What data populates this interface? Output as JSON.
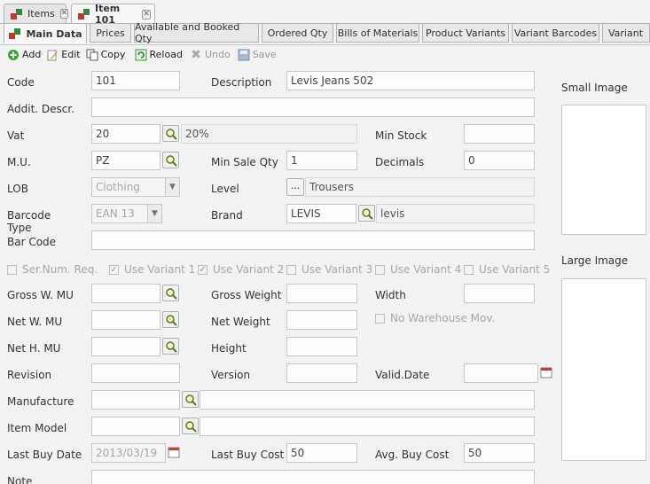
{
  "window_tabs": [
    {
      "label": "Items"
    },
    {
      "label": "Item 101"
    }
  ],
  "sub_tabs": [
    "Main Data",
    "Prices",
    "Available and Booked Qty",
    "Ordered Qty",
    "Bills of Materials",
    "Product Variants",
    "Variant Barcodes",
    "Variant"
  ],
  "toolbar": {
    "add": "Add",
    "edit": "Edit",
    "copy": "Copy",
    "reload": "Reload",
    "undo": "Undo",
    "save": "Save"
  },
  "form": {
    "code": {
      "label": "Code",
      "value": "101"
    },
    "description": {
      "label": "Description",
      "value": "Levis Jeans 502"
    },
    "addit_descr": {
      "label": "Addit. Descr.",
      "value": ""
    },
    "vat": {
      "label": "Vat",
      "value": "20",
      "desc": "20%"
    },
    "min_stock": {
      "label": "Min Stock",
      "value": ""
    },
    "mu": {
      "label": "M.U.",
      "value": "PZ"
    },
    "min_sale_qty": {
      "label": "Min Sale Qty",
      "value": "1"
    },
    "decimals": {
      "label": "Decimals",
      "value": "0"
    },
    "lob": {
      "label": "LOB",
      "value": "Clothing"
    },
    "level": {
      "label": "Level",
      "value": "Trousers",
      "button": "..."
    },
    "barcode_type": {
      "label_line1": "Barcode",
      "label_line2": "Type",
      "value": "EAN 13"
    },
    "brand": {
      "label": "Brand",
      "value": "LEVIS",
      "desc": "levis"
    },
    "bar_code": {
      "label": "Bar Code",
      "value": ""
    },
    "checkboxes": [
      {
        "label": "Ser.Num. Req.",
        "checked": false
      },
      {
        "label": "Use Variant 1",
        "checked": true
      },
      {
        "label": "Use Variant 2",
        "checked": true
      },
      {
        "label": "Use Variant 3",
        "checked": false
      },
      {
        "label": "Use Variant 4",
        "checked": false
      },
      {
        "label": "Use Variant 5",
        "checked": false
      }
    ],
    "gross_w_mu": {
      "label": "Gross W. MU",
      "value": ""
    },
    "gross_weight": {
      "label": "Gross Weight",
      "value": ""
    },
    "width": {
      "label": "Width",
      "value": ""
    },
    "net_w_mu": {
      "label": "Net W. MU",
      "value": ""
    },
    "net_weight": {
      "label": "Net Weight",
      "value": ""
    },
    "no_warehouse_mov": {
      "label": "No Warehouse Mov.",
      "checked": false
    },
    "net_h_mu": {
      "label": "Net H. MU",
      "value": ""
    },
    "height": {
      "label": "Height",
      "value": ""
    },
    "revision": {
      "label": "Revision",
      "value": ""
    },
    "version": {
      "label": "Version",
      "value": ""
    },
    "valid_date": {
      "label": "Valid.Date",
      "value": ""
    },
    "manufacture": {
      "label": "Manufacture",
      "value": "",
      "desc": ""
    },
    "item_model": {
      "label": "Item Model",
      "value": "",
      "desc": ""
    },
    "last_buy_date": {
      "label": "Last Buy Date",
      "value": "2013/03/19"
    },
    "last_buy_cost": {
      "label": "Last Buy Cost",
      "value": "50"
    },
    "avg_buy_cost": {
      "label": "Avg. Buy Cost",
      "value": "50"
    },
    "note": {
      "label": "Note",
      "value": ""
    }
  },
  "images": {
    "small": "Small Image",
    "large": "Large Image"
  },
  "colors": {
    "background": "#f2f2f2",
    "field_border": "#c8c8c8",
    "disabled_text": "#a8a8a8"
  }
}
